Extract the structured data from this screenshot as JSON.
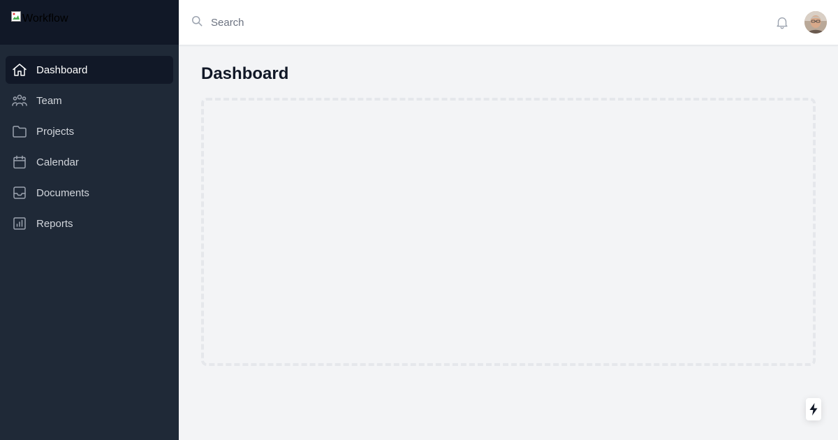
{
  "brand": {
    "logo_alt": "Workflow"
  },
  "sidebar": {
    "items": [
      {
        "label": "Dashboard",
        "icon": "home-icon",
        "active": true
      },
      {
        "label": "Team",
        "icon": "users-icon",
        "active": false
      },
      {
        "label": "Projects",
        "icon": "folder-icon",
        "active": false
      },
      {
        "label": "Calendar",
        "icon": "calendar-icon",
        "active": false
      },
      {
        "label": "Documents",
        "icon": "inbox-icon",
        "active": false
      },
      {
        "label": "Reports",
        "icon": "chart-bar-icon",
        "active": false
      }
    ]
  },
  "topbar": {
    "search": {
      "placeholder": "Search",
      "icon": "search-icon"
    },
    "notifications_icon": "bell-icon",
    "avatar": "user-avatar"
  },
  "main": {
    "title": "Dashboard"
  },
  "fab": {
    "icon": "lightning-bolt-icon"
  },
  "colors": {
    "sidebar_bg": "#1f2937",
    "sidebar_brand_bg": "#111827",
    "active_item_bg": "#111827",
    "main_bg": "#f3f4f6",
    "topbar_bg": "#ffffff"
  }
}
